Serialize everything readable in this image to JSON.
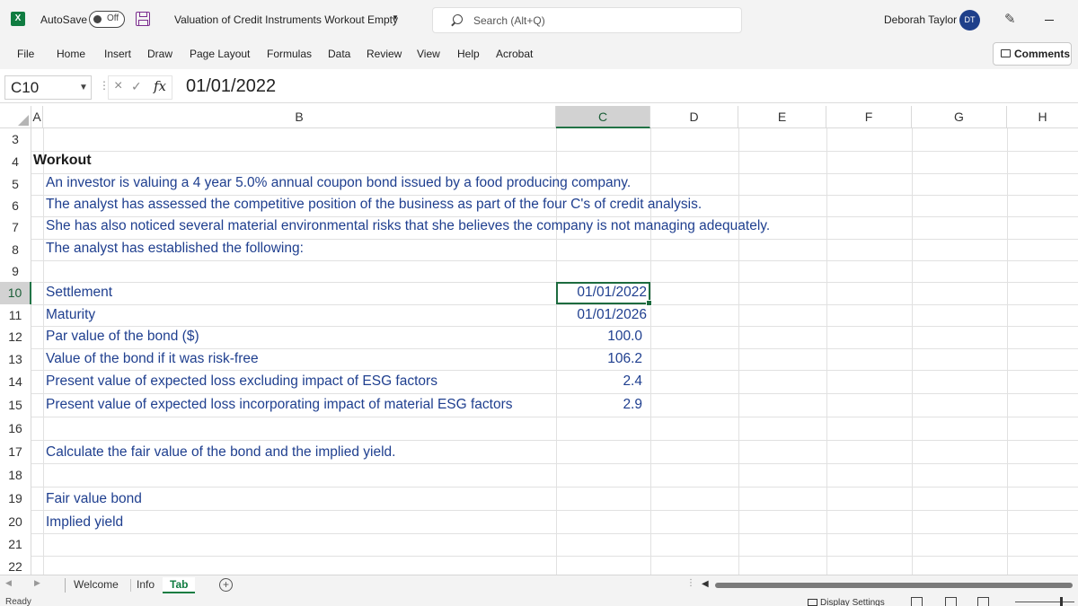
{
  "titlebar": {
    "app_icon": "X",
    "autosave_label": "AutoSave",
    "autosave_state": "Off",
    "doc_title": "Valuation of Credit Instruments Workout Empty",
    "search_placeholder": "Search (Alt+Q)",
    "user_name": "Deborah Taylor",
    "user_initials": "DT"
  },
  "ribbon": {
    "tabs": [
      "File",
      "Home",
      "Insert",
      "Draw",
      "Page Layout",
      "Formulas",
      "Data",
      "Review",
      "View",
      "Help",
      "Acrobat"
    ],
    "comments_label": "Comments"
  },
  "formula_bar": {
    "name_box": "C10",
    "fx_label": "fx",
    "value": "01/01/2022"
  },
  "grid": {
    "columns": [
      "A",
      "B",
      "C",
      "D",
      "E",
      "F",
      "G",
      "H"
    ],
    "selected_column": "C",
    "rows": [
      "3",
      "4",
      "5",
      "6",
      "7",
      "8",
      "9",
      "10",
      "11",
      "12",
      "13",
      "14",
      "15",
      "16",
      "17",
      "18",
      "19",
      "20",
      "21",
      "22"
    ],
    "selected_row": "10",
    "heading": "Workout",
    "description": [
      "An investor is valuing a 4 year 5.0% annual coupon bond issued by a food producing company.",
      "The analyst has assessed the competitive position of the business as part of the four C's of credit analysis.",
      "She has also noticed several material environmental risks that she believes the company is not managing adequately.",
      "The analyst has established the following:"
    ],
    "inputs": [
      {
        "label": "Settlement",
        "value": "01/01/2022"
      },
      {
        "label": "Maturity",
        "value": "01/01/2026"
      },
      {
        "label": "Par value of the bond ($)",
        "value": "100.0"
      },
      {
        "label": "Value of the bond if it was risk-free",
        "value": "106.2"
      },
      {
        "label": "Present value of expected loss excluding impact of ESG factors",
        "value": "2.4"
      },
      {
        "label": "Present value of expected loss incorporating impact of material ESG factors",
        "value": "2.9"
      }
    ],
    "task": "Calculate the fair value of the bond and the implied yield.",
    "outputs": [
      "Fair value bond",
      "Implied yield"
    ]
  },
  "sheets": {
    "tabs": [
      "Welcome",
      "Info",
      "Tab"
    ],
    "active": "Tab",
    "add_label": "+"
  },
  "status": {
    "ready": "Ready",
    "display_settings": "Display Settings"
  }
}
